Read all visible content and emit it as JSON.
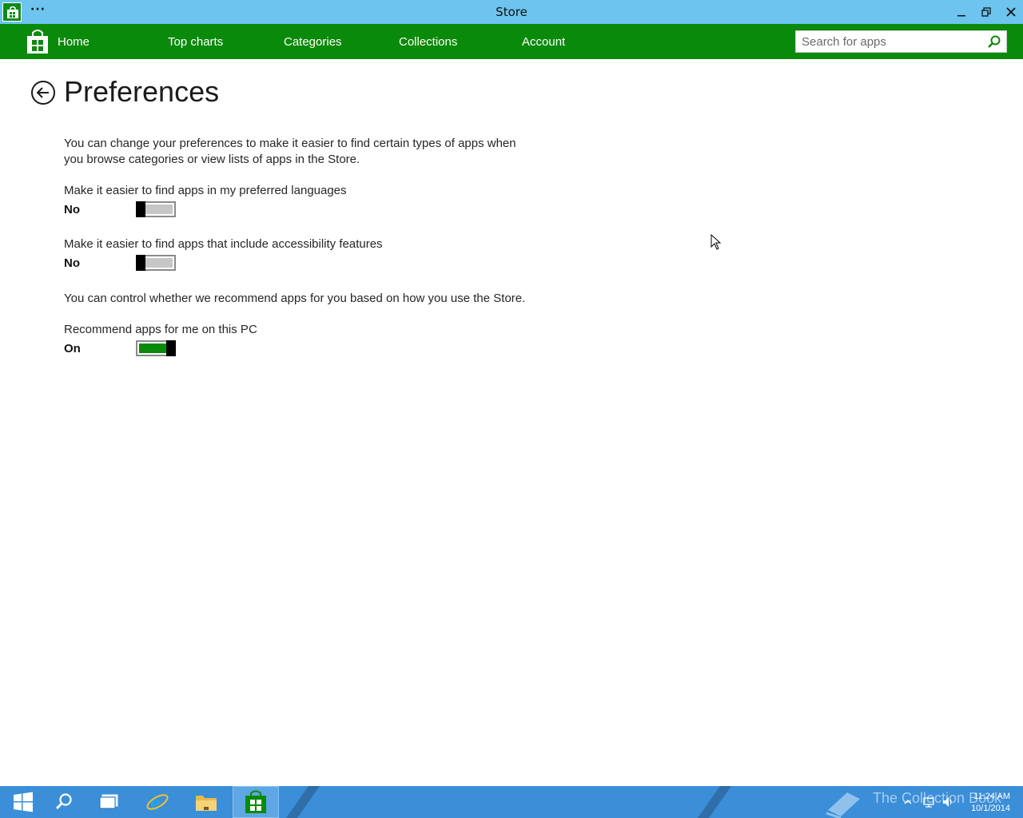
{
  "window": {
    "title": "Store",
    "menu_glyph": "···"
  },
  "nav": {
    "items": [
      "Home",
      "Top charts",
      "Categories",
      "Collections",
      "Account"
    ]
  },
  "search": {
    "placeholder": "Search for apps"
  },
  "page": {
    "title": "Preferences",
    "intro": "You can change your preferences to make it easier to find certain types of apps when you browse categories or view lists of apps in the Store.",
    "settings": [
      {
        "label": "Make it easier to find apps in my preferred languages",
        "state": "No",
        "on": false
      },
      {
        "label": "Make it easier to find apps that include accessibility features",
        "state": "No",
        "on": false
      }
    ],
    "recommend_intro": "You can control whether we recommend apps for you based on how you use the Store.",
    "recommend": {
      "label": "Recommend apps for me on this PC",
      "state": "On",
      "on": true
    }
  },
  "colors": {
    "titlebar": "#6cc4ef",
    "navbar": "#0a8a0a",
    "toggle_on": "#0a8a0a",
    "taskbar": "#3b8ed8"
  },
  "taskbar": {
    "icons": [
      "windows-start-icon",
      "search-icon",
      "task-view-icon",
      "internet-explorer-icon",
      "file-explorer-icon",
      "store-icon"
    ],
    "watermark": "The Collection Book",
    "time": "11:24 AM",
    "date": "10/1/2014"
  }
}
